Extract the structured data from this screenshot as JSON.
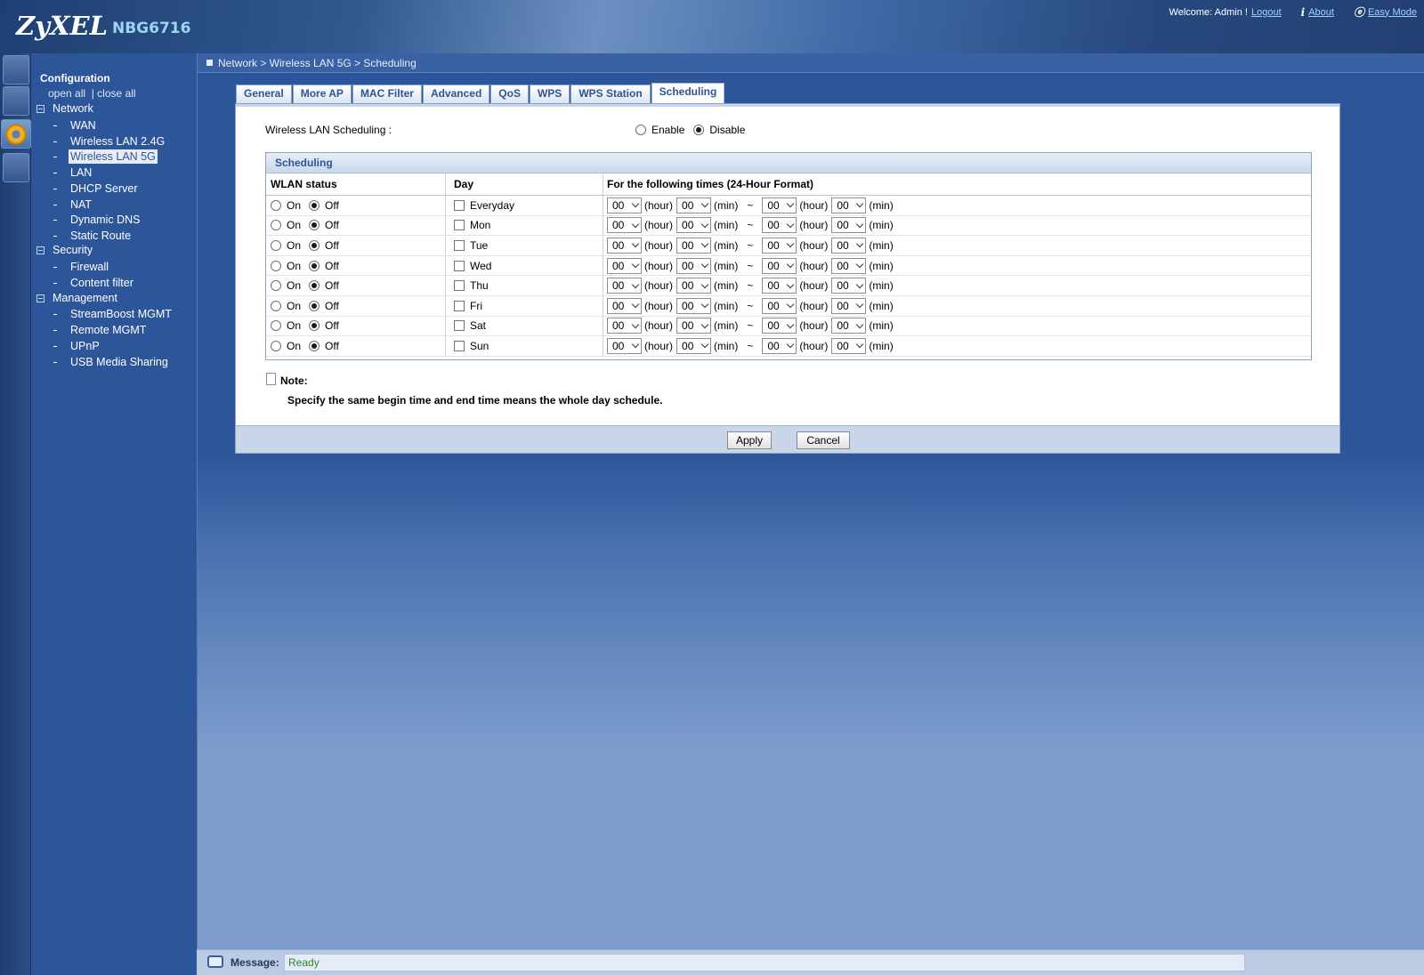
{
  "header": {
    "brand": "ZyXEL",
    "model": "NBG6716",
    "welcome": "Welcome: Admin !",
    "logout": "Logout",
    "about": "About",
    "easy_mode": "Easy Mode"
  },
  "sidebar": {
    "title": "Configuration",
    "open_all": "open all",
    "close_all": "| close all",
    "groups": [
      {
        "label": "Network",
        "items": [
          "WAN",
          "Wireless LAN 2.4G",
          "Wireless LAN 5G",
          "LAN",
          "DHCP Server",
          "NAT",
          "Dynamic DNS",
          "Static Route"
        ]
      },
      {
        "label": "Security",
        "items": [
          "Firewall",
          "Content filter"
        ]
      },
      {
        "label": "Management",
        "items": [
          "StreamBoost MGMT",
          "Remote MGMT",
          "UPnP",
          "USB Media Sharing"
        ]
      }
    ],
    "active_item": "Wireless LAN 5G"
  },
  "breadcrumb": "Network > Wireless LAN 5G > Scheduling",
  "tabs": [
    "General",
    "More AP",
    "MAC Filter",
    "Advanced",
    "QoS",
    "WPS",
    "WPS Station",
    "Scheduling"
  ],
  "active_tab": "Scheduling",
  "wls": {
    "label": "Wireless LAN Scheduling :",
    "enable": "Enable",
    "disable": "Disable",
    "selected": "Disable"
  },
  "schedule": {
    "section_title": "Scheduling",
    "headers": {
      "status": "WLAN status",
      "day": "Day",
      "times": "For the following times (24-Hour Format)"
    },
    "on_label": "On",
    "off_label": "Off",
    "hour_unit": "(hour)",
    "min_unit": "(min)",
    "tilde": "~",
    "rows": [
      {
        "day": "Everyday",
        "status": "Off",
        "start_hour": "00",
        "start_min": "00",
        "end_hour": "00",
        "end_min": "00"
      },
      {
        "day": "Mon",
        "status": "Off",
        "start_hour": "00",
        "start_min": "00",
        "end_hour": "00",
        "end_min": "00"
      },
      {
        "day": "Tue",
        "status": "Off",
        "start_hour": "00",
        "start_min": "00",
        "end_hour": "00",
        "end_min": "00"
      },
      {
        "day": "Wed",
        "status": "Off",
        "start_hour": "00",
        "start_min": "00",
        "end_hour": "00",
        "end_min": "00"
      },
      {
        "day": "Thu",
        "status": "Off",
        "start_hour": "00",
        "start_min": "00",
        "end_hour": "00",
        "end_min": "00"
      },
      {
        "day": "Fri",
        "status": "Off",
        "start_hour": "00",
        "start_min": "00",
        "end_hour": "00",
        "end_min": "00"
      },
      {
        "day": "Sat",
        "status": "Off",
        "start_hour": "00",
        "start_min": "00",
        "end_hour": "00",
        "end_min": "00"
      },
      {
        "day": "Sun",
        "status": "Off",
        "start_hour": "00",
        "start_min": "00",
        "end_hour": "00",
        "end_min": "00"
      }
    ]
  },
  "note": {
    "label": "Note:",
    "text": "Specify the same begin time and end time means the whole day schedule."
  },
  "buttons": {
    "apply": "Apply",
    "cancel": "Cancel"
  },
  "status": {
    "label": "Message:",
    "value": "Ready"
  }
}
